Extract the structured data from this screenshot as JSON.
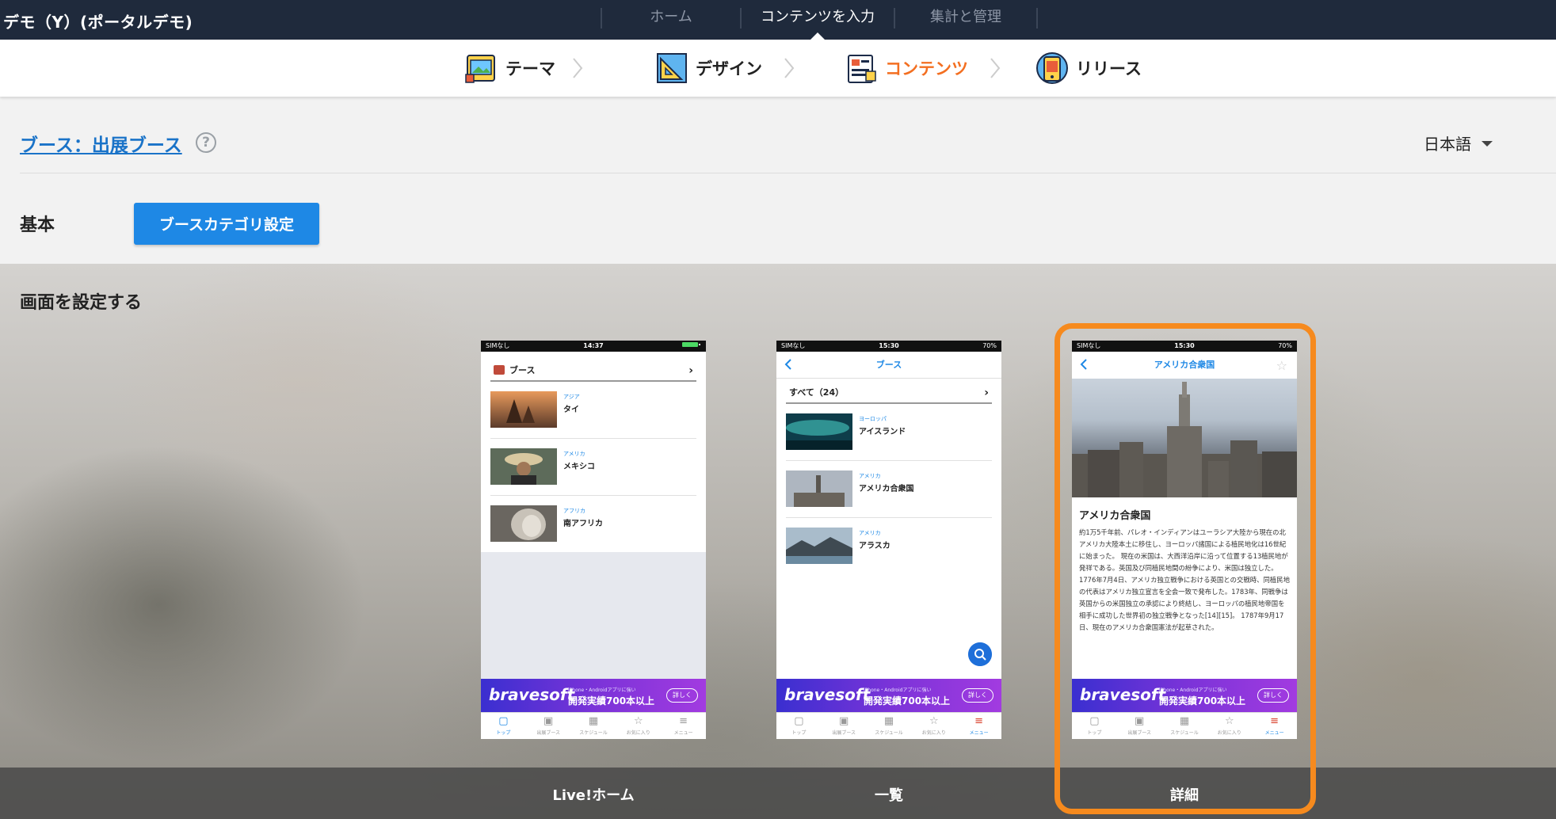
{
  "app": {
    "title": "デモ（Y）(ポータルデモ)"
  },
  "top_nav": {
    "items": [
      "ホーム",
      "コンテンツを入力",
      "集計と管理"
    ],
    "active_index": 1
  },
  "steps": [
    {
      "label": "テーマ",
      "icon": "theme-icon"
    },
    {
      "label": "デザイン",
      "icon": "design-icon"
    },
    {
      "label": "コンテンツ",
      "icon": "content-icon",
      "active": true
    },
    {
      "label": "リリース",
      "icon": "release-icon"
    }
  ],
  "header": {
    "breadcrumb": "ブース：出展ブース",
    "help": "?",
    "language": "日本語"
  },
  "basic": {
    "label": "基本",
    "category_button": "ブースカテゴリ設定"
  },
  "screens": {
    "title": "画面を設定する",
    "captions": [
      "Live!ホーム",
      "一覧",
      "詳細"
    ],
    "selected": "詳細"
  },
  "phone_home": {
    "status_left": "SIMなし",
    "status_time": "14:37",
    "section_title": "ブース",
    "rows": [
      {
        "region": "アジア",
        "name": "タイ"
      },
      {
        "region": "アメリカ",
        "name": "メキシコ"
      },
      {
        "region": "アフリカ",
        "name": "南アフリカ"
      }
    ]
  },
  "phone_list": {
    "status_left": "SIMなし",
    "status_time": "15:30",
    "status_right": "70%",
    "nav_title": "ブース",
    "section_title": "すべて（24）",
    "rows": [
      {
        "region": "ヨーロッパ",
        "name": "アイスランド"
      },
      {
        "region": "アメリカ",
        "name": "アメリカ合衆国"
      },
      {
        "region": "アメリカ",
        "name": "アラスカ"
      }
    ]
  },
  "phone_detail": {
    "status_left": "SIMなし",
    "status_time": "15:30",
    "status_right": "70%",
    "nav_title": "アメリカ合衆国",
    "heading": "アメリカ合衆国",
    "body": "約1万5千年前、パレオ・インディアンはユーラシア大陸から現在の北アメリカ大陸本土に移住し、ヨーロッパ諸国による植民地化は16世紀に始まった。 現在の米国は、大西洋沿岸に沿って位置する13植民地が発祥である。英国及び同植民地間の紛争により、米国は独立した。 1776年7月4日、アメリカ独立戦争における英国との交戦時、同植民地の代表はアメリカ独立宣言を全会一致で発布した。1783年、同戦争は英国からの米国独立の承認により終結し、ヨーロッパの植民地帝国を相手に成功した世界初の独立戦争となった[14][15]。 1787年9月17日、現在のアメリカ合衆国憲法が起草された。"
  },
  "banner": {
    "brand": "bravesoft",
    "small": "iPhone・Androidアプリに強い",
    "big": "開発実績700本以上",
    "button": "詳しく"
  },
  "tabbar": {
    "labels": [
      "トップ",
      "出展ブース",
      "スケジュール",
      "お気に入り",
      "メニュー"
    ]
  },
  "colors": {
    "accent_orange": "#f36f21",
    "link_blue": "#1a73c8",
    "button_blue": "#1e88e5",
    "highlight": "#f68a1e",
    "topbar": "#1f2a3c"
  }
}
